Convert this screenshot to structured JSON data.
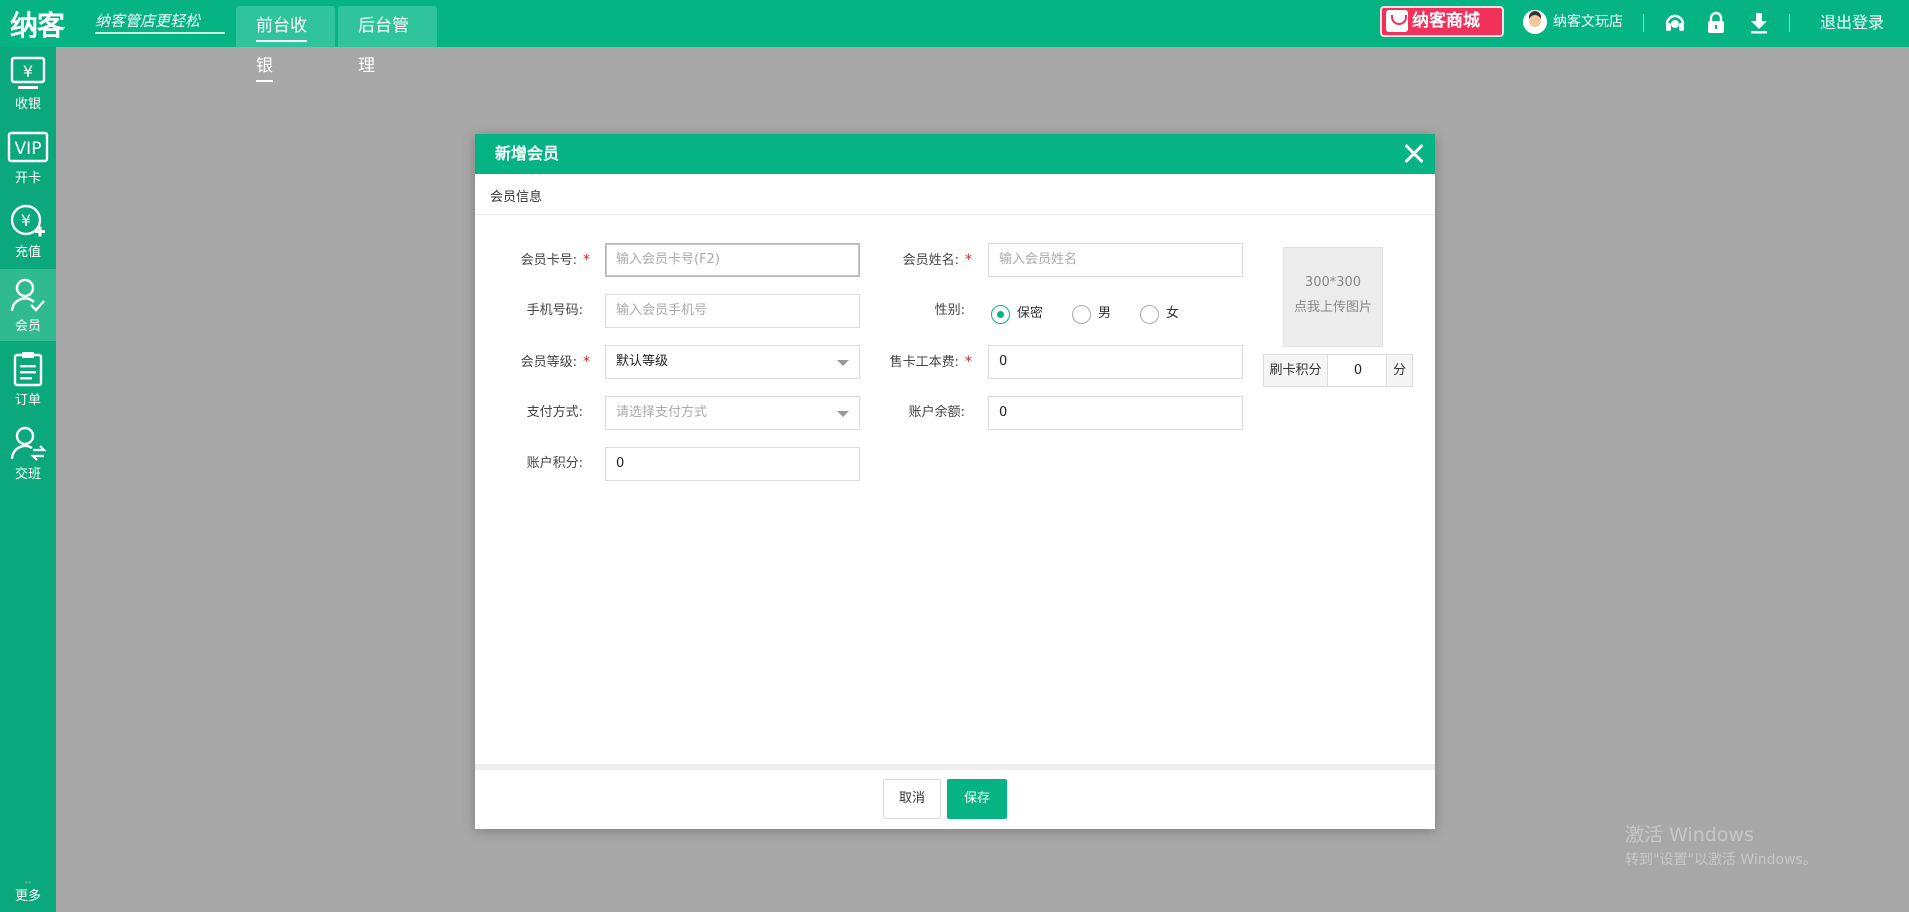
{
  "header": {
    "logo": "纳客",
    "slogan": "纳客管店更轻松",
    "tabs": [
      {
        "label": "前台收银",
        "active": true
      },
      {
        "label": "后台管理",
        "active": false
      }
    ],
    "mall_label": "纳客商城",
    "user_name": "纳客文玩店",
    "logout_label": "退出登录",
    "icons": [
      "headset-icon",
      "lock-icon",
      "download-icon"
    ],
    "accent_color": "#05b383",
    "mall_color": "#f1315a"
  },
  "sidebar": {
    "items": [
      {
        "label": "收银",
        "icon": "cash-register-icon",
        "active": false
      },
      {
        "label": "开卡",
        "icon": "vip-card-icon",
        "active": false
      },
      {
        "label": "充值",
        "icon": "recharge-icon",
        "active": false
      },
      {
        "label": "会员",
        "icon": "member-icon",
        "active": true
      },
      {
        "label": "订单",
        "icon": "order-icon",
        "active": false
      },
      {
        "label": "交班",
        "icon": "shift-handover-icon",
        "active": false
      }
    ],
    "more_label": "更多",
    "more_dots": ".."
  },
  "dialog": {
    "title": "新增会员",
    "section_title": "会员信息",
    "fields": {
      "card_no": {
        "label": "会员卡号:",
        "placeholder": "输入会员卡号(F2)",
        "value": "",
        "required": true
      },
      "name": {
        "label": "会员姓名:",
        "placeholder": "输入会员姓名",
        "value": "",
        "required": true
      },
      "phone": {
        "label": "手机号码:",
        "placeholder": "输入会员手机号",
        "value": "",
        "required": false
      },
      "gender": {
        "label": "性别:",
        "options": [
          "保密",
          "男",
          "女"
        ],
        "selected": "保密"
      },
      "level": {
        "label": "会员等级:",
        "value": "默认等级",
        "required": true
      },
      "card_fee": {
        "label": "售卡工本费:",
        "value": "0",
        "required": true
      },
      "payment": {
        "label": "支付方式:",
        "placeholder": "请选择支付方式",
        "value": ""
      },
      "balance": {
        "label": "账户余额:",
        "value": "0"
      },
      "points": {
        "label": "账户积分:",
        "value": "0"
      }
    },
    "required_mark": "*",
    "upload": {
      "size": "300*300",
      "hint": "点我上传图片"
    },
    "swipe_points": {
      "label": "刷卡积分",
      "value": "0",
      "unit": "分"
    },
    "buttons": {
      "cancel": "取消",
      "save": "保存"
    }
  },
  "watermark": {
    "line1": "激活 Windows",
    "line2": "转到\"设置\"以激活 Windows。"
  }
}
